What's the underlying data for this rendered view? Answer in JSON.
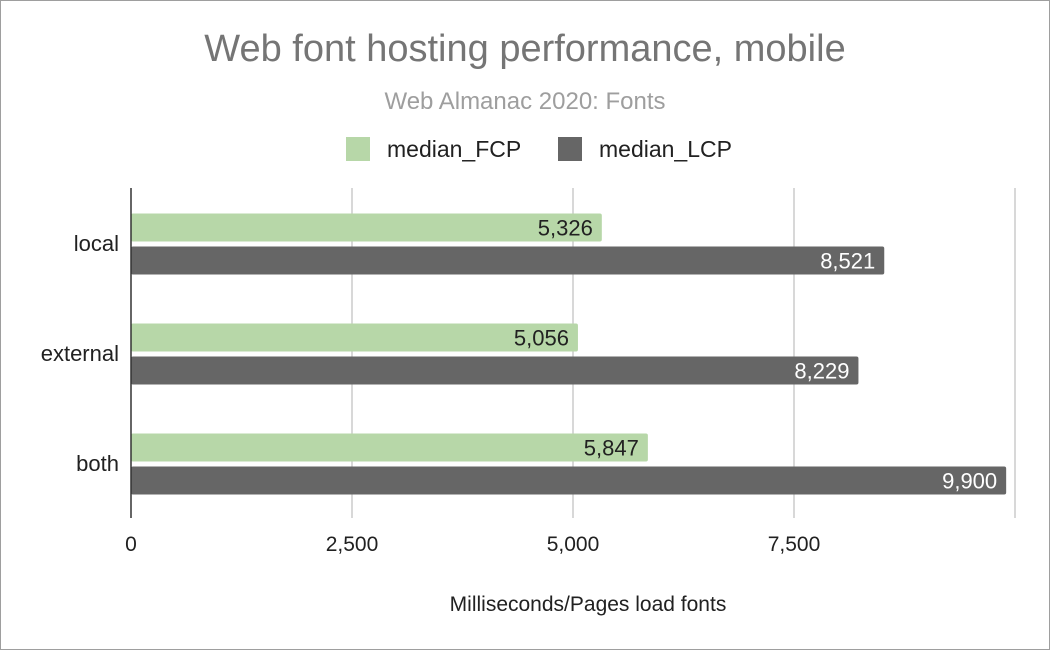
{
  "chart_data": {
    "type": "bar",
    "orientation": "horizontal",
    "title": "Web font hosting performance, mobile",
    "subtitle": "Web Almanac 2020: Fonts",
    "xlabel": "Milliseconds/Pages load fonts",
    "ylabel": "",
    "categories": [
      "local",
      "external",
      "both"
    ],
    "series": [
      {
        "name": "median_FCP",
        "color": "#b7d7a8",
        "label_color": "#212121",
        "values": [
          5326,
          5056,
          5847
        ],
        "labels": [
          "5,326",
          "5,056",
          "5,847"
        ]
      },
      {
        "name": "median_LCP",
        "color": "#666666",
        "label_color": "#ffffff",
        "values": [
          8521,
          8229,
          9900
        ],
        "labels": [
          "8,521",
          "8,229",
          "9,900"
        ]
      }
    ],
    "xlim": [
      0,
      10000
    ],
    "xticks": [
      0,
      2500,
      5000,
      7500
    ],
    "xtick_labels": [
      "0",
      "2,500",
      "5,000",
      "7,500"
    ],
    "grid": true,
    "legend_position": "top"
  }
}
